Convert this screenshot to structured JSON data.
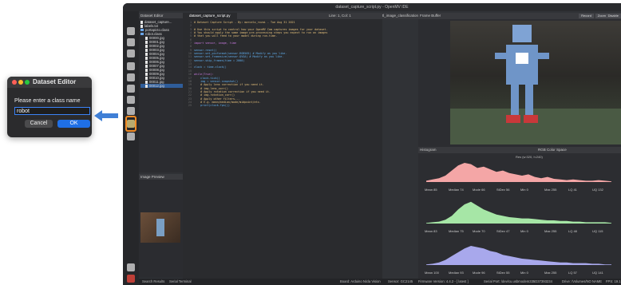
{
  "dialog": {
    "title": "Dataset Editor",
    "prompt": "Please enter a class name",
    "input_value": "robot",
    "cancel_label": "Cancel",
    "ok_label": "OK"
  },
  "ide": {
    "window_title": "dataset_capture_script.py - OpenMV IDE",
    "explorer_title": "Dataset Editor",
    "files": [
      {
        "name": "dataset_capture...",
        "kind": "doc"
      },
      {
        "name": "labels.txt",
        "kind": "doc"
      },
      {
        "name": "portapicto.class",
        "kind": "folder"
      },
      {
        "name": "robot.class",
        "kind": "folder"
      },
      {
        "name": "00000.jpg",
        "kind": "doc"
      },
      {
        "name": "00001.jpg",
        "kind": "doc"
      },
      {
        "name": "00002.jpg",
        "kind": "doc"
      },
      {
        "name": "00003.jpg",
        "kind": "doc"
      },
      {
        "name": "00004.jpg",
        "kind": "doc"
      },
      {
        "name": "00005.jpg",
        "kind": "doc"
      },
      {
        "name": "00006.jpg",
        "kind": "doc"
      },
      {
        "name": "00007.jpg",
        "kind": "doc"
      },
      {
        "name": "00008.jpg",
        "kind": "doc"
      },
      {
        "name": "00009.jpg",
        "kind": "doc"
      },
      {
        "name": "00010.jpg",
        "kind": "doc"
      },
      {
        "name": "00011.jpg",
        "kind": "doc"
      },
      {
        "name": "00012.jpg",
        "kind": "doc"
      }
    ],
    "preview_title": "Image Preview",
    "tabs": [
      "dataset_capture_script.py",
      "tl_image_classification.py",
      "dataset_capture_script.py"
    ],
    "position": "Line: 1, Col: 1",
    "code": [
      "# Dataset Capture Script - By: marcelo_rovai - Tue Aug 31 2021",
      "",
      "# Use this script to control how your OpenMV Cam captures images for your dataset.",
      "# You should apply the same image pre-processing steps you expect to run on images",
      "# that you will feed to your model during run-time.",
      "",
      "import sensor, image, time",
      "",
      "sensor.reset()",
      "sensor.set_pixformat(sensor.RGB565) # Modify as you like.",
      "sensor.set_framesize(sensor.QVGA) # Modify as you like.",
      "sensor.skip_frames(time = 2000)",
      "",
      "clock = time.clock()",
      "",
      "while(True):",
      "    clock.tick()",
      "    img = sensor.snapshot()",
      "    # Apply lens correction if you need it.",
      "    # img.lens_corr()",
      "    # Apply rotation correction if you need it.",
      "    # img.rotation_corr()",
      "    # Apply other filters...",
      "    # E.g. mean/median/mode/midpoint/etc.",
      "    print(clock.fps())"
    ],
    "frame_buffer_title": "Frame Buffer",
    "fb_buttons": [
      "Record",
      "Zoom",
      "Disable"
    ],
    "histogram_title": "Histogram",
    "color_space": "RGB Color Space",
    "resolution": "Res (w:320, h:240)",
    "channels": [
      {
        "color": "#f4a6a6",
        "mean": "85",
        "median": "74",
        "mode": "66",
        "stdev": "56",
        "min": "0",
        "max": "255",
        "lq": "41",
        "uq": "132"
      },
      {
        "color": "#a6e6a6",
        "mean": "83",
        "median": "75",
        "mode": "70",
        "stdev": "47",
        "min": "0",
        "max": "255",
        "lq": "48",
        "uq": "115"
      },
      {
        "color": "#a8a8ec",
        "mean": "100",
        "median": "93",
        "mode": "96",
        "stdev": "55",
        "min": "0",
        "max": "255",
        "lq": "57",
        "uq": "141"
      }
    ],
    "status": {
      "search": "Search Results",
      "terminal": "Serial Terminal",
      "board": "Board: Arduino Nicla Vision",
      "sensor": "Sensor: GC2145",
      "firmware": "Firmware Version: 4.4.2 - [ latest ]",
      "port": "Serial Port: /dev/cu.usbmodem335D37393234",
      "drive": "Drive: /Volumes/NO NAME",
      "fps": "FPS: 19.1"
    }
  },
  "arrow_color": "#3f7fd6",
  "highlight_color": "#f08a24"
}
